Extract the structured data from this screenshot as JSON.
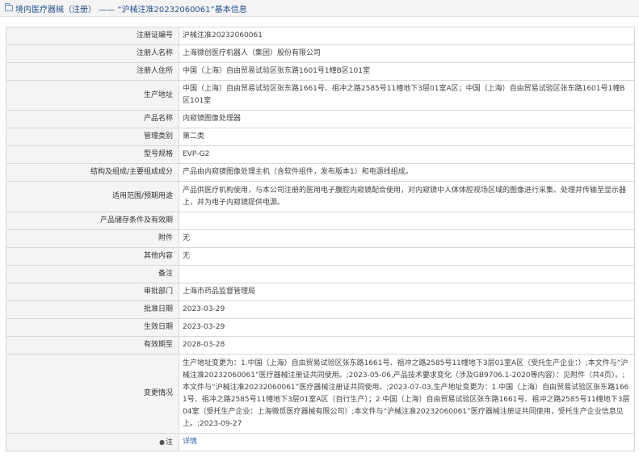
{
  "header": {
    "title": "境内医疗器械（注册） —— “沪械注准20232060061”基本信息"
  },
  "rows": [
    {
      "label": "注册证编号",
      "value": "沪械注准20232060061"
    },
    {
      "label": "注册人名称",
      "value": "上海微创医疗机器人（集团）股份有限公司"
    },
    {
      "label": "注册人住所",
      "value": "中国（上海）自由贸易试验区张东路1601号1幢B区101室"
    },
    {
      "label": "生产地址",
      "value": "中国（上海）自由贸易试验区张东路1661号、祖冲之路2585号11幢地下3层01室A区；中国（上海）自由贸易试验区张东路1601号1幢B区101室"
    },
    {
      "label": "产品名称",
      "value": "内窥镜图像处理器"
    },
    {
      "label": "管理类别",
      "value": "第二类"
    },
    {
      "label": "型号规格",
      "value": "EVP-G2"
    },
    {
      "label": "结构及组成/主要组成成分",
      "value": "产品由内窥镜图像处理主机（含软件组件，发布版本1）和电源线组成。"
    },
    {
      "label": "适用范围/预期用途",
      "value": "产品供医疗机构使用，与本公司注册的医用电子腹腔内窥镜配合使用，对内窥镜中人体体腔视场区域的图像进行采集、处理并传输至显示器上，并为电子内窥镜提供电源。"
    },
    {
      "label": "产品储存条件及有效期",
      "value": ""
    },
    {
      "label": "附件",
      "value": "无"
    },
    {
      "label": "其他内容",
      "value": "无"
    },
    {
      "label": "备注",
      "value": ""
    },
    {
      "label": "审批部门",
      "value": "上海市药品监督管理局"
    },
    {
      "label": "批准日期",
      "value": "2023-03-29"
    },
    {
      "label": "生效日期",
      "value": "2023-03-29"
    },
    {
      "label": "有效期至",
      "value": "2028-03-28"
    },
    {
      "label": "变更情况",
      "value": "生产地址变更为：1.中国（上海）自由贸易试验区张东路1661号、祖冲之路2585号11幢地下3层01室A区（受托生产企业：）;本文件与“沪械注准20232060061”医疗器械注册证共同使用。;2023-05-06,产品技术要求变化（涉及GB9706.1-2020等内容）：见附件（共4页）。;本文件与“沪械注准20232060061”医疗器械注册证共同使用。;2023-07-03,生产地址变更为：1.中国（上海）自由贸易试验区张东路1661号、祖冲之路2585号11幢地下3层01室A区（自行生产）；2.中国（上海）自由贸易试验区张东路1661号、祖冲之路2585号11幢地下3层04室（受托生产企业：上海微觅医疗器械有限公司）;本文件与“沪械注准20232060061”医疗器械注册证共同使用，受托生产企业信息见上。;2023-09-27"
    }
  ],
  "note": {
    "label": "注",
    "icon": "bell-icon",
    "link_text": "详情"
  }
}
